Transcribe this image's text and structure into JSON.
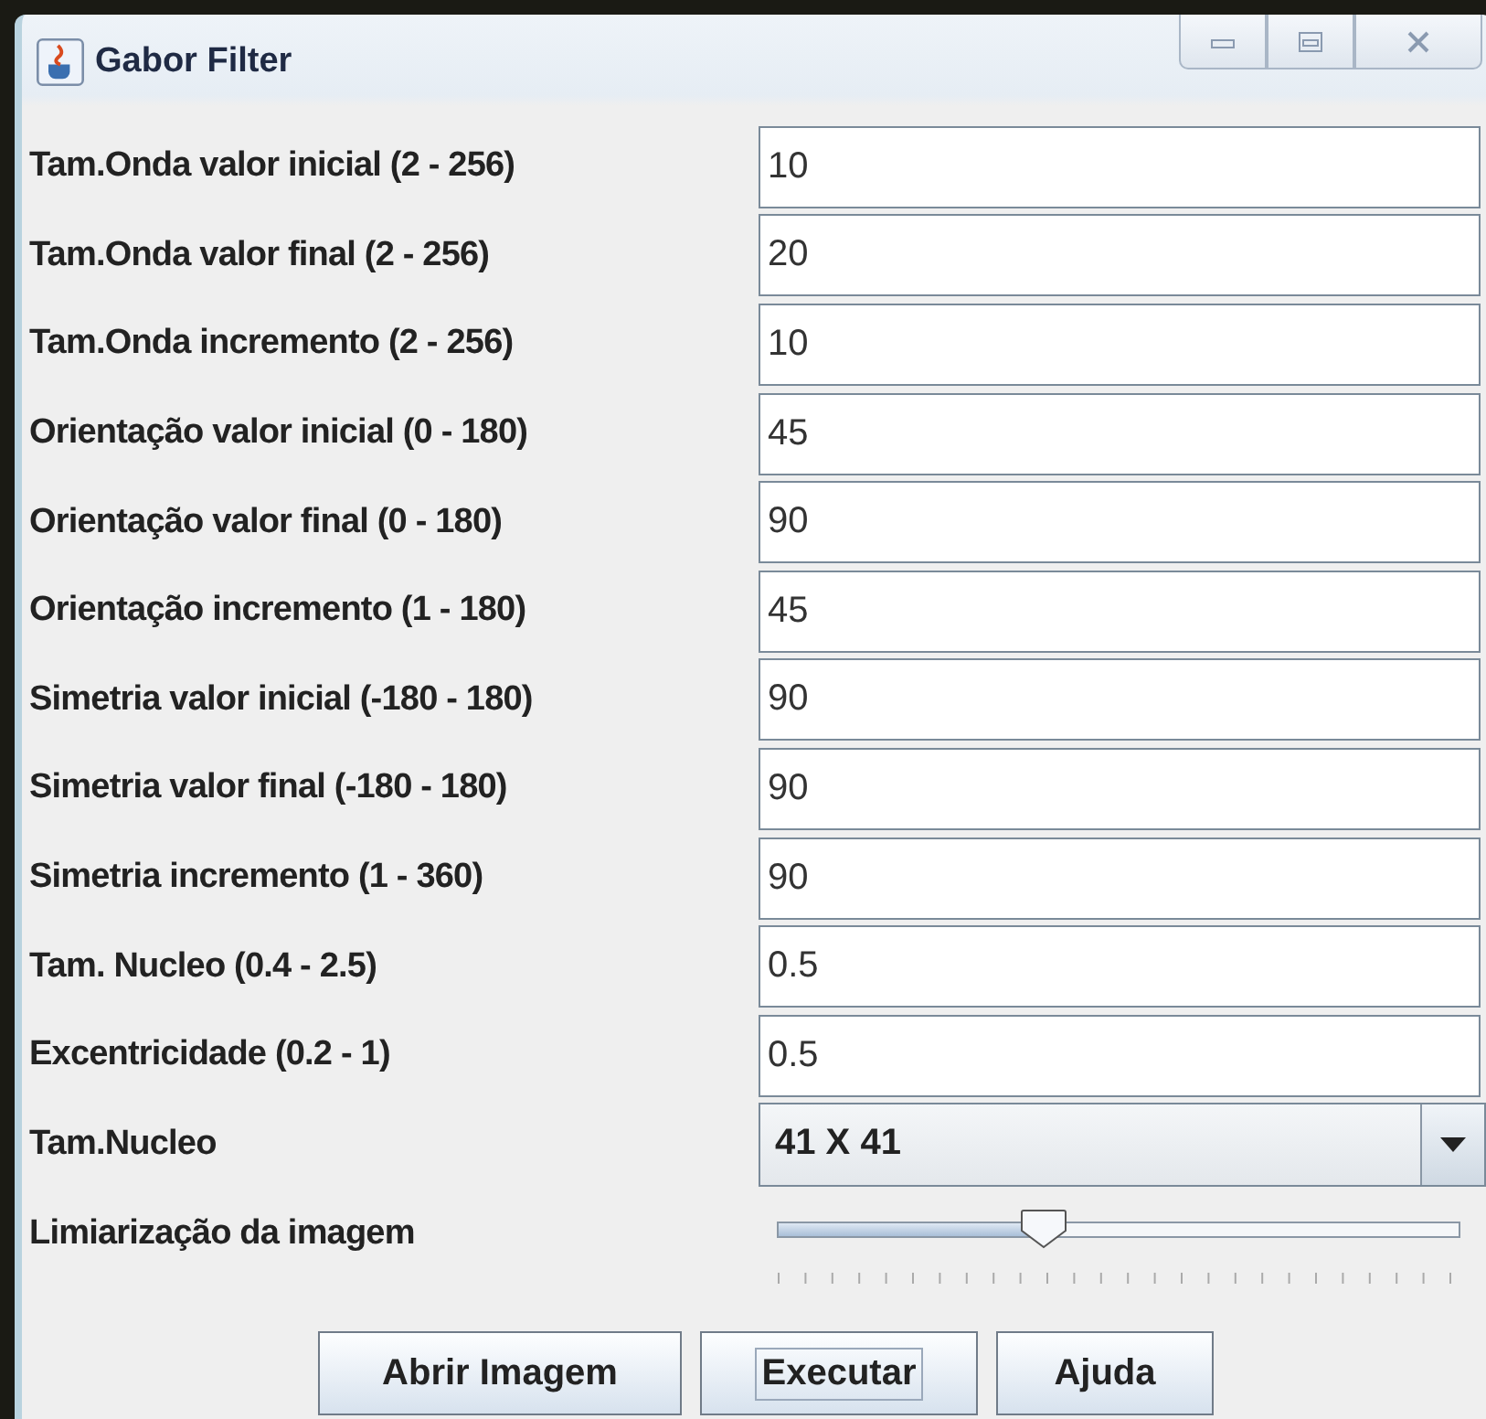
{
  "window": {
    "title": "Gabor Filter"
  },
  "fields": [
    {
      "label": "Tam.Onda valor inicial (2 - 256)",
      "value": "10"
    },
    {
      "label": "Tam.Onda valor final (2 - 256)",
      "value": "20"
    },
    {
      "label": "Tam.Onda incremento (2 - 256)",
      "value": "10"
    },
    {
      "label": "Orientação valor inicial (0 - 180)",
      "value": "45"
    },
    {
      "label": "Orientação valor final (0 - 180)",
      "value": "90"
    },
    {
      "label": "Orientação incremento (1 - 180)",
      "value": "45"
    },
    {
      "label": "Simetria valor inicial (-180 - 180)",
      "value": "90"
    },
    {
      "label": "Simetria valor final (-180 - 180)",
      "value": "90"
    },
    {
      "label": "Simetria incremento (1 - 360)",
      "value": "90"
    },
    {
      "label": "Tam. Nucleo (0.4 - 2.5)",
      "value": "0.5"
    },
    {
      "label": "Excentricidade (0.2 - 1)",
      "value": "0.5"
    }
  ],
  "kernel": {
    "label": "Tam.Nucleo",
    "value": "41 X 41"
  },
  "threshold": {
    "label": "Limiarização da imagem",
    "level": 0.39
  },
  "buttons": [
    {
      "label": "Abrir Imagem",
      "focused": false
    },
    {
      "label": "Executar",
      "focused": true
    },
    {
      "label": "Ajuda",
      "focused": false
    }
  ]
}
